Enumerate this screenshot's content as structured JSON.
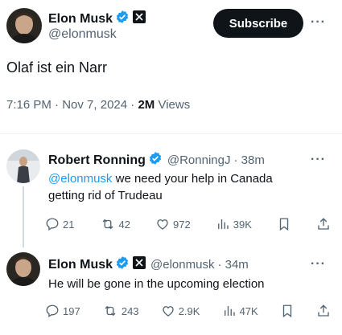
{
  "main_post": {
    "author_name": "Elon Musk",
    "author_handle": "@elonmusk",
    "subscribe_label": "Subscribe",
    "more_label": "···",
    "text": "Olaf ist ein Narr",
    "time": "7:16 PM",
    "date": "Nov 7, 2024",
    "views_count": "2M",
    "views_label": "Views"
  },
  "replies": [
    {
      "author_name": "Robert Ronning",
      "author_handle": "@RonningJ",
      "age": "· 38m",
      "more_label": "···",
      "mention": "@elonmusk",
      "text": " we need your help in Canada getting rid of Trudeau",
      "stats": {
        "replies": "21",
        "reposts": "42",
        "likes": "972",
        "views": "39K"
      }
    },
    {
      "author_name": "Elon Musk",
      "author_handle": "@elonmusk",
      "age": "· 34m",
      "more_label": "···",
      "text": "He will be gone in the upcoming election",
      "stats": {
        "replies": "197",
        "reposts": "243",
        "likes": "2.9K",
        "views": "47K"
      }
    }
  ],
  "colors": {
    "verified": "#1d9bf0",
    "text": "#0f1419",
    "muted": "#536471",
    "link": "#1d9bf0"
  },
  "icons": [
    "verified-badge-icon",
    "x-affiliate-icon",
    "reply-icon",
    "repost-icon",
    "like-icon",
    "views-icon",
    "bookmark-icon",
    "share-icon"
  ]
}
